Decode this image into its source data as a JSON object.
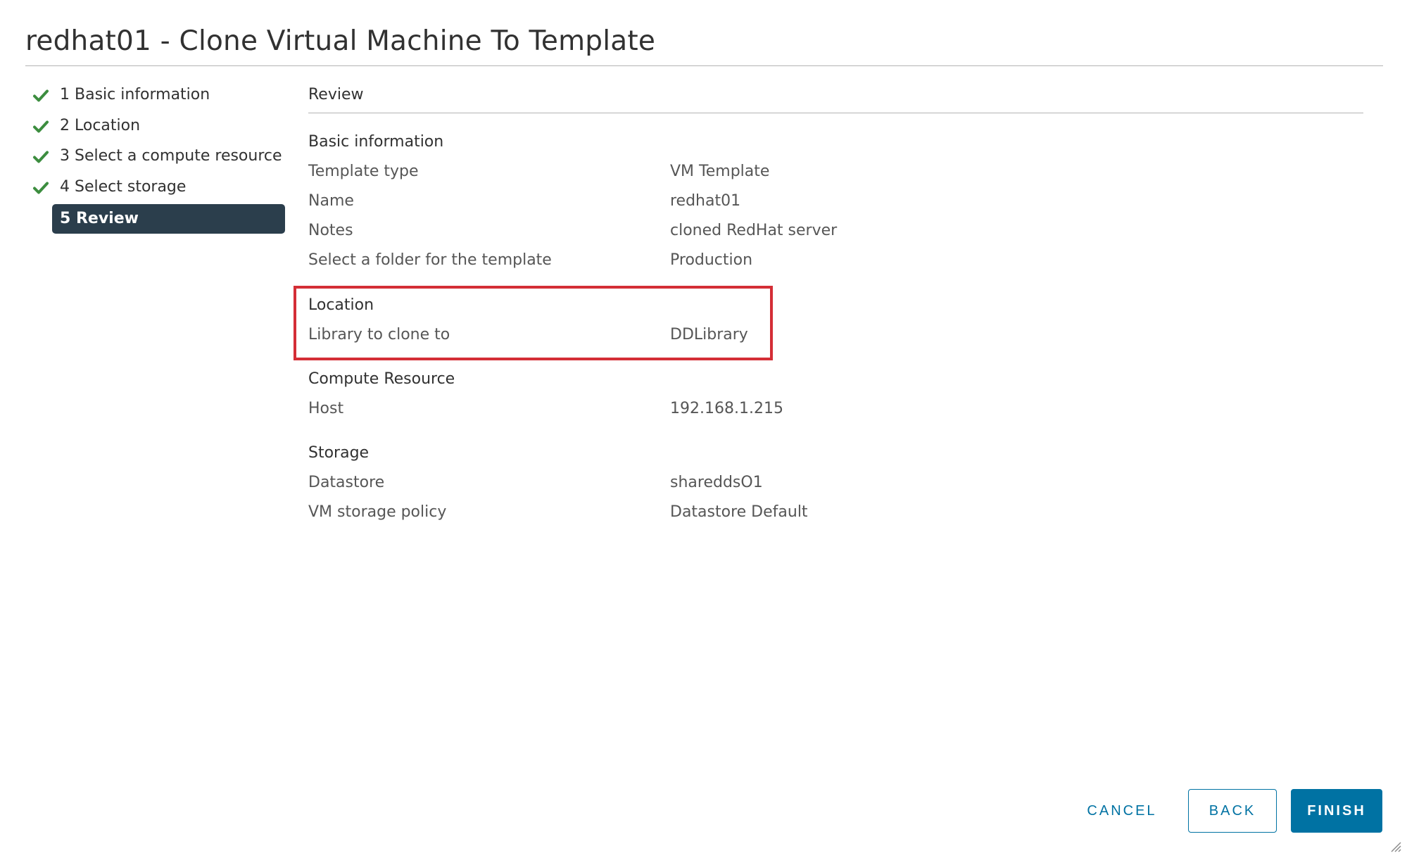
{
  "dialog": {
    "title": "redhat01 - Clone Virtual Machine To Template"
  },
  "steps": [
    {
      "label": "1 Basic information",
      "status": "complete"
    },
    {
      "label": "2 Location",
      "status": "complete"
    },
    {
      "label": "3 Select a compute resource",
      "status": "complete"
    },
    {
      "label": "4 Select storage",
      "status": "complete"
    },
    {
      "label": "5 Review",
      "status": "active"
    }
  ],
  "review": {
    "heading": "Review",
    "basic_information": {
      "title": "Basic information",
      "rows": [
        {
          "label": "Template type",
          "value": "VM Template"
        },
        {
          "label": "Name",
          "value": "redhat01"
        },
        {
          "label": "Notes",
          "value": "cloned RedHat server"
        },
        {
          "label": "Select a folder for the template",
          "value": "Production"
        }
      ]
    },
    "location": {
      "title": "Location",
      "rows": [
        {
          "label": "Library to clone to",
          "value": "DDLibrary"
        }
      ]
    },
    "compute_resource": {
      "title": "Compute Resource",
      "rows": [
        {
          "label": "Host",
          "value": "192.168.1.215"
        }
      ]
    },
    "storage": {
      "title": "Storage",
      "rows": [
        {
          "label": "Datastore",
          "value": "shareddsO1"
        },
        {
          "label": "VM storage policy",
          "value": "Datastore Default"
        }
      ]
    }
  },
  "footer": {
    "cancel_label": "CANCEL",
    "back_label": "BACK",
    "finish_label": "FINISH"
  },
  "colors": {
    "check": "#3c8d3f",
    "active_step_bg": "#2b3e4c",
    "primary": "#0072a3",
    "highlight": "#d42e36"
  },
  "icons": {
    "step_complete": "check-icon",
    "resize": "resize-grip-icon"
  }
}
